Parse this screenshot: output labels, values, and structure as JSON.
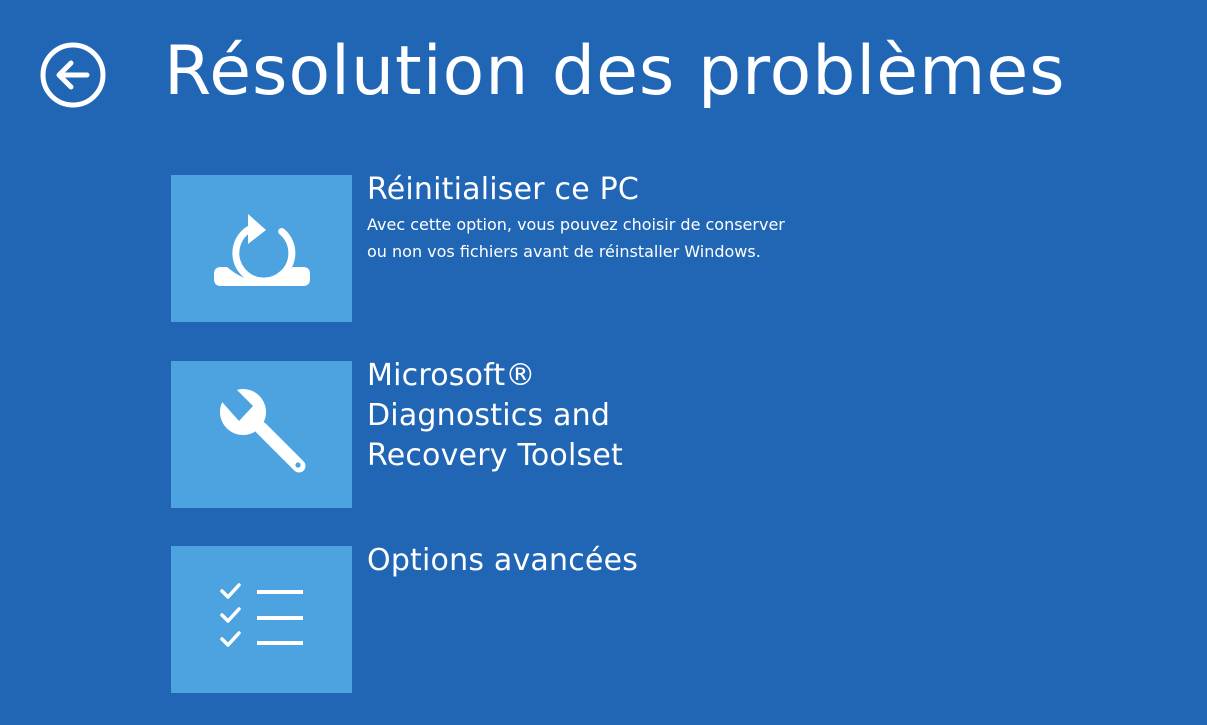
{
  "header": {
    "title": "Résolution des problèmes",
    "back_icon": "back-arrow-circle-icon"
  },
  "options": [
    {
      "title": "Réinitialiser ce PC",
      "description": "Avec cette option, vous pouvez choisir de conserver ou non vos fichiers avant de réinstaller Windows.",
      "icon": "reset-pc-icon"
    },
    {
      "title": "Microsoft® Diagnostics and Recovery Toolset",
      "description": "",
      "icon": "wrench-icon"
    },
    {
      "title": "Options avancées",
      "description": "",
      "icon": "checklist-icon"
    }
  ],
  "colors": {
    "background": "#2166b5",
    "tile": "#4da3e0",
    "text": "#ffffff"
  }
}
